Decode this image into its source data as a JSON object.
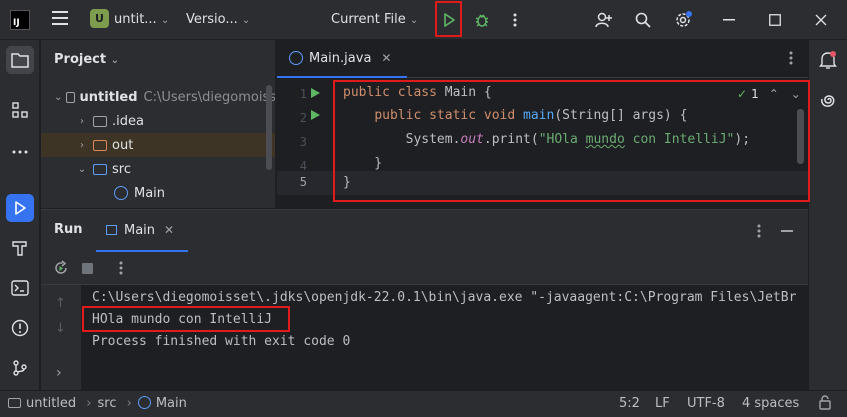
{
  "titlebar": {
    "logo": "IJ",
    "project_badge": "U",
    "project_name": "untit...",
    "vcs_label": "Versio...",
    "run_config": "Current File"
  },
  "project_panel": {
    "title": "Project",
    "tree": [
      {
        "label": "untitled",
        "path": "C:\\Users\\diegomoiss"
      },
      {
        "label": ".idea"
      },
      {
        "label": "out"
      },
      {
        "label": "src"
      },
      {
        "label": "Main"
      }
    ]
  },
  "editor": {
    "tab_label": "Main.java",
    "line_numbers": [
      "1",
      "2",
      "3",
      "4",
      "5"
    ],
    "inspection_count": "1"
  },
  "run_panel": {
    "title": "Run",
    "tab_label": "Main",
    "output": [
      "C:\\Users\\diegomoisset\\.jdks\\openjdk-22.0.1\\bin\\java.exe \"-javaagent:C:\\Program Files\\JetBr",
      "HOla mundo con IntelliJ",
      "Process finished with exit code 0"
    ]
  },
  "statusbar": {
    "crumbs": [
      "untitled",
      "src",
      "Main"
    ],
    "position": "5:2",
    "line_sep": "LF",
    "encoding": "UTF-8",
    "indent": "4 spaces"
  },
  "colors": {
    "accent": "#3573f0",
    "run_green": "#5fb865",
    "highlight_red": "#e01b1b"
  }
}
